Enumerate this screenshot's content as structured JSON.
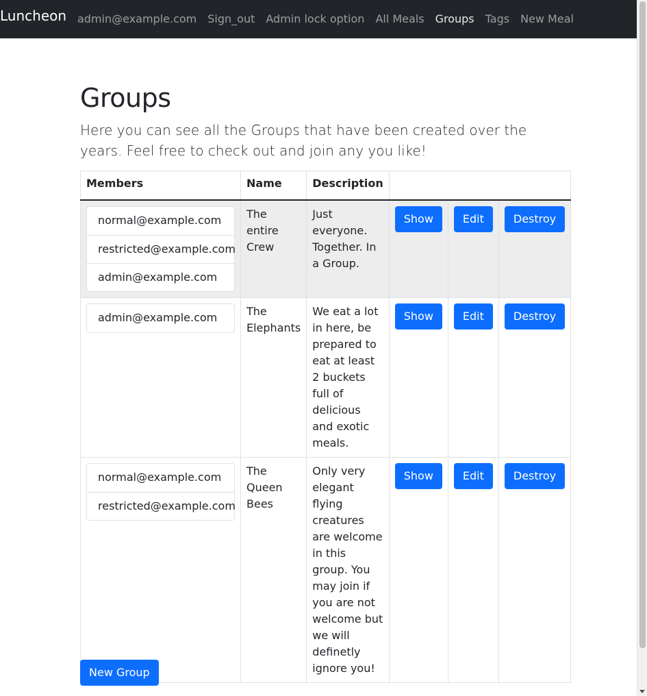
{
  "navbar": {
    "brand": "Luncheon",
    "links": [
      {
        "label": "admin@example.com"
      },
      {
        "label": "Sign_out"
      },
      {
        "label": "Admin lock option"
      },
      {
        "label": "All Meals"
      },
      {
        "label": "Groups"
      },
      {
        "label": "Tags"
      },
      {
        "label": "New Meal"
      }
    ],
    "active": "Groups"
  },
  "page": {
    "title": "Groups",
    "lead": "Here you can see all the Groups that have been created over the years. Feel free to check out and join any you like!"
  },
  "table": {
    "headers": {
      "members": "Members",
      "name": "Name",
      "description": "Description",
      "actions": ""
    },
    "rows": [
      {
        "members": [
          "normal@example.com",
          "restricted@example.com",
          "admin@example.com"
        ],
        "name": "The entire Crew",
        "description": "Just everyone. Together. In a Group.",
        "show": "Show",
        "edit": "Edit",
        "destroy": "Destroy"
      },
      {
        "members": [
          "admin@example.com"
        ],
        "name": "The Elephants",
        "description": "We eat a lot in here, be prepared to eat at least 2 buckets full of delicious and exotic meals.",
        "show": "Show",
        "edit": "Edit",
        "destroy": "Destroy"
      },
      {
        "members": [
          "normal@example.com",
          "restricted@example.com"
        ],
        "name": "The Queen Bees",
        "description": "Only very elegant flying creatures are welcome in this group. You may join if you are not welcome but we will definetly ignore you!",
        "show": "Show",
        "edit": "Edit",
        "destroy": "Destroy"
      }
    ]
  },
  "actions": {
    "new_group": "New Group"
  },
  "colors": {
    "navbar_bg": "#212529",
    "primary": "#0d6efd",
    "striped_row": "#ededed"
  }
}
